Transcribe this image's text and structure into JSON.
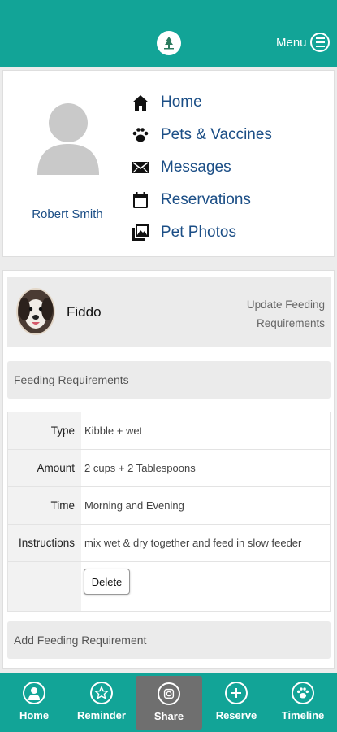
{
  "header": {
    "menu_label": "Menu"
  },
  "profile": {
    "user_name": "Robert Smith",
    "nav": [
      {
        "label": "Home",
        "icon": "home-icon"
      },
      {
        "label": "Pets & Vaccines",
        "icon": "paw-icon"
      },
      {
        "label": "Messages",
        "icon": "envelope-icon"
      },
      {
        "label": "Reservations",
        "icon": "calendar-icon"
      },
      {
        "label": "Pet Photos",
        "icon": "photos-icon"
      }
    ]
  },
  "pet": {
    "name": "Fiddo",
    "update_link": "Update Feeding Requirements"
  },
  "feeding": {
    "section_title": "Feeding Requirements",
    "rows": [
      {
        "label": "Type",
        "value": "Kibble + wet"
      },
      {
        "label": "Amount",
        "value": "2 cups + 2 Tablespoons"
      },
      {
        "label": "Time",
        "value": "Morning and Evening"
      },
      {
        "label": "Instructions",
        "value": "mix wet & dry together and feed in slow feeder"
      }
    ],
    "delete_label": "Delete",
    "add_label": "Add Feeding Requirement"
  },
  "bottom_nav": [
    {
      "label": "Home",
      "icon": "person-icon"
    },
    {
      "label": "Reminder",
      "icon": "star-icon"
    },
    {
      "label": "Share",
      "icon": "camera-icon",
      "active": true
    },
    {
      "label": "Reserve",
      "icon": "plus-icon"
    },
    {
      "label": "Timeline",
      "icon": "paw-icon"
    }
  ],
  "colors": {
    "brand": "#12a497",
    "link": "#1b4e86",
    "active_tab": "#6f6f6f"
  }
}
